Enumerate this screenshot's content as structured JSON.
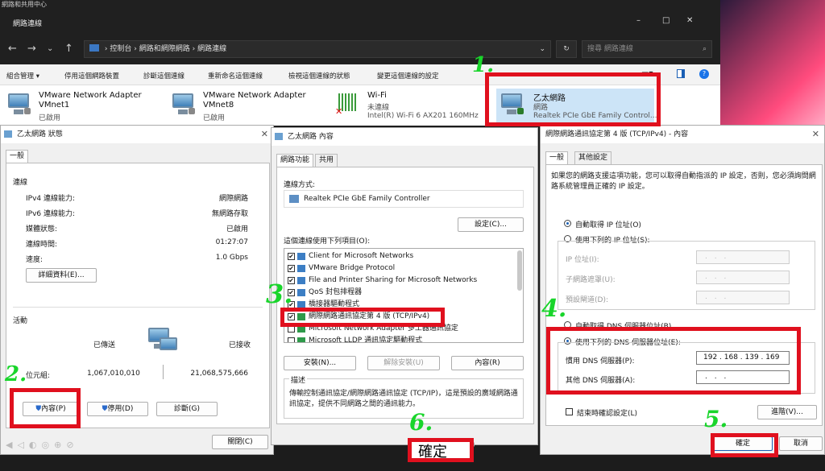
{
  "explorer": {
    "old_title": "網路和共用中心",
    "title": "網路連線",
    "window_controls": [
      "–",
      "□",
      "✕"
    ],
    "breadcrumb": [
      "控制台",
      "網路和網際網路",
      "網路連線"
    ],
    "search_placeholder": "搜尋 網路連線",
    "commands": [
      "組合管理 ▾",
      "停用這個網路裝置",
      "診斷這個連線",
      "重新命名這個連線",
      "檢視這個連線的狀態",
      "變更這個連線的設定"
    ],
    "adapters": [
      {
        "name": "VMware Network Adapter VMnet1",
        "status": "已啟用",
        "device": ""
      },
      {
        "name": "VMware Network Adapter VMnet8",
        "status": "已啟用",
        "device": ""
      },
      {
        "name": "Wi-Fi",
        "status": "未連線",
        "device": "Intel(R) Wi-Fi 6 AX201 160MHz"
      },
      {
        "name": "乙太網路",
        "status": "網路",
        "device": "Realtek PCIe GbE Family Control..."
      }
    ]
  },
  "status_dialog": {
    "title": "乙太網路 狀態",
    "tab": "一般",
    "section_connection": "連線",
    "rows": [
      {
        "label": "IPv4 連線能力:",
        "value": "網際網路"
      },
      {
        "label": "IPv6 連線能力:",
        "value": "無網路存取"
      },
      {
        "label": "媒體狀態:",
        "value": "已啟用"
      },
      {
        "label": "連線時間:",
        "value": "01:27:07"
      },
      {
        "label": "速度:",
        "value": "1.0 Gbps"
      }
    ],
    "details_button": "詳細資料(E)...",
    "section_activity": "活動",
    "sent_label": "已傳送",
    "received_label": "已接收",
    "bytes_label": "位元組:",
    "bytes_sent": "1,067,010,010",
    "bytes_received": "21,068,575,666",
    "properties_button": "內容(P)",
    "disable_button": "停用(D)",
    "diagnose_button": "診斷(G)",
    "close_button": "關閉(C)"
  },
  "props_dialog": {
    "title": "乙太網路 內容",
    "tabs": [
      "網路功能",
      "共用"
    ],
    "connect_using_label": "連線方式:",
    "adapter_name": "Realtek PCIe GbE Family Controller",
    "configure_button": "設定(C)...",
    "items_label": "這個連線使用下列項目(O):",
    "items": [
      {
        "label": "Client for Microsoft Networks",
        "checked": true
      },
      {
        "label": "VMware Bridge Protocol",
        "checked": true
      },
      {
        "label": "File and Printer Sharing for Microsoft Networks",
        "checked": true
      },
      {
        "label": "QoS 封包排程器",
        "checked": true
      },
      {
        "label": "橋接器驅動程式",
        "checked": true
      },
      {
        "label": "網際網路通訊協定第 4 版 (TCP/IPv4)",
        "checked": true
      },
      {
        "label": "Microsoft Network Adapter 多工器通訊協定",
        "checked": false
      },
      {
        "label": "Microsoft LLDP 通訊協定驅動程式",
        "checked": false
      }
    ],
    "install_button": "安裝(N)...",
    "uninstall_button": "解除安裝(U)",
    "properties_button": "內容(R)",
    "description_label": "描述",
    "description": "傳輸控制通訊協定/網際網路通訊協定 (TCP/IP)，這是預設的廣域網路通訊協定，提供不同網路之間的通訊能力。",
    "ok_button": "確定"
  },
  "ipv4_dialog": {
    "title": "網際網路通訊協定第 4 版 (TCP/IPv4) - 內容",
    "tabs": [
      "一般",
      "其他設定"
    ],
    "intro": "如果您的網路支援這項功能，您可以取得自動指派的 IP 設定，否則，您必須詢問網路系統管理員正確的 IP 設定。",
    "auto_ip": "自動取得 IP 位址(O)",
    "manual_ip": "使用下列的 IP 位址(S):",
    "ip_label": "IP 位址(I):",
    "mask_label": "子網路遮罩(U):",
    "gateway_label": "預設閘道(D):",
    "auto_dns": "自動取得 DNS 伺服器位址(B)",
    "manual_dns": "使用下列的 DNS 伺服器位址(E):",
    "preferred_dns_label": "慣用 DNS 伺服器(P):",
    "preferred_dns": "192 . 168 . 139 . 169",
    "alternate_dns_label": "其他 DNS 伺服器(A):",
    "empty_ip": ". . .",
    "validate_label": "結束時確認設定(L)",
    "advanced_button": "進階(V)...",
    "ok_button": "確定",
    "cancel_button": "取消"
  },
  "annotations": [
    "1.",
    "2.",
    "3.",
    "4.",
    "5.",
    "6."
  ],
  "colors": {
    "annotation_red": "#e0101e",
    "annotation_green": "#19d52b"
  }
}
